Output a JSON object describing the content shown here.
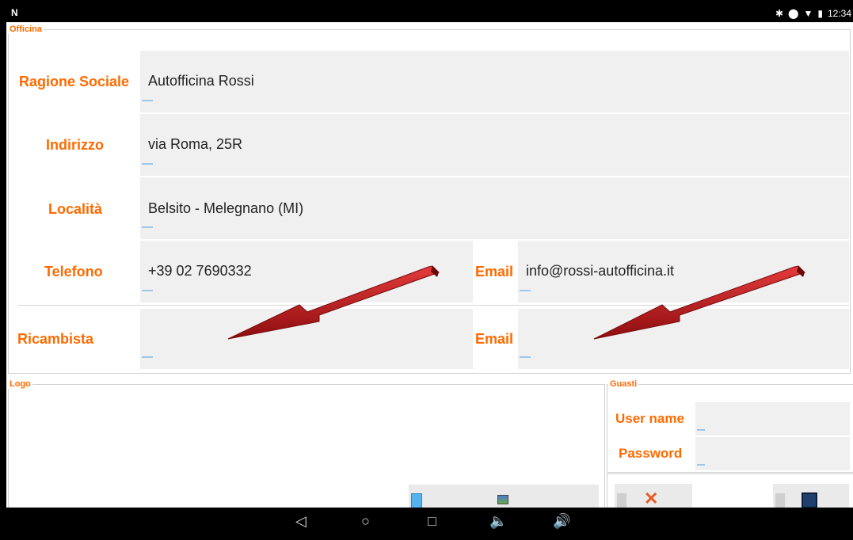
{
  "status_bar": {
    "app_icon": "N",
    "time": "12:34"
  },
  "officina": {
    "group_label": "Officina",
    "ragione_sociale": {
      "label": "Ragione Sociale",
      "value": "Autofficina Rossi"
    },
    "indirizzo": {
      "label": "Indirizzo",
      "value": "via Roma, 25R"
    },
    "localita": {
      "label": "Località",
      "value": "Belsito - Melegnano (MI)"
    },
    "telefono": {
      "label": "Telefono",
      "value": "+39 02 7690332"
    },
    "email": {
      "label": "Email",
      "value": "info@rossi-autofficina.it"
    }
  },
  "ricambista": {
    "label": "Ricambista",
    "value": "",
    "email_label": "Email",
    "email_value": ""
  },
  "logo": {
    "group_label": "Logo"
  },
  "guasti": {
    "group_label": "Guasti",
    "user_name_label": "User name",
    "user_name_value": "",
    "password_label": "Password",
    "password_value": ""
  },
  "colors": {
    "accent": "#ff6a00",
    "field_bg": "#f0f0f0",
    "arrow": "#c0181b"
  },
  "icons": [
    "back-icon",
    "home-icon",
    "recents-icon",
    "volume-down-icon",
    "volume-up-icon",
    "cancel-icon",
    "save-icon",
    "gallery-icon",
    "phone-icon"
  ]
}
